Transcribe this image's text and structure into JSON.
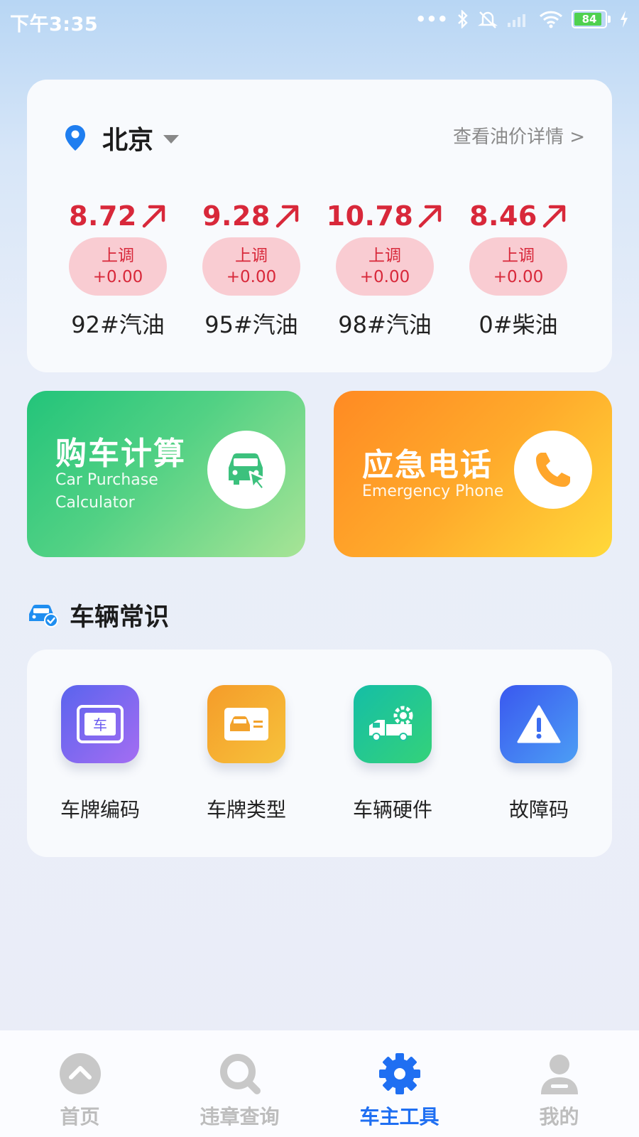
{
  "status_bar": {
    "time": "下午3:35",
    "battery": "84"
  },
  "header": {
    "city": "北京",
    "detail_link": "查看油价详情 >"
  },
  "fuel_prices": [
    {
      "price": "8.72",
      "trend": "上调",
      "change": "+0.00",
      "name": "92#汽油"
    },
    {
      "price": "9.28",
      "trend": "上调",
      "change": "+0.00",
      "name": "95#汽油"
    },
    {
      "price": "10.78",
      "trend": "上调",
      "change": "+0.00",
      "name": "98#汽油"
    },
    {
      "price": "8.46",
      "trend": "上调",
      "change": "+0.00",
      "name": "0#柴油"
    }
  ],
  "actions": {
    "purchase": {
      "title": "购车计算",
      "subtitle_line1": "Car Purchase",
      "subtitle_line2": "Calculator",
      "icon": "car-cursor-icon"
    },
    "emergency": {
      "title": "应急电话",
      "subtitle": "Emergency Phone",
      "icon": "phone-icon"
    }
  },
  "section": {
    "title": "车辆常识",
    "icon": "car-check-icon"
  },
  "tools": [
    {
      "label": "车牌编码",
      "icon": "plate-icon",
      "color": "#6b5cf0"
    },
    {
      "label": "车牌类型",
      "icon": "plate-card-icon",
      "color": "#f2a22c"
    },
    {
      "label": "车辆硬件",
      "icon": "truck-gear-icon",
      "color": "#22c4a0"
    },
    {
      "label": "故障码",
      "icon": "warning-icon",
      "color": "#3a6cf0"
    }
  ],
  "nav": [
    {
      "label": "首页",
      "icon": "home-icon",
      "active": false
    },
    {
      "label": "违章查询",
      "icon": "search-icon",
      "active": false
    },
    {
      "label": "车主工具",
      "icon": "gear-icon",
      "active": true
    },
    {
      "label": "我的",
      "icon": "user-icon",
      "active": false
    }
  ],
  "colors": {
    "accent": "#1f6ff2",
    "price_red": "#d8283a",
    "pill_bg": "#f9ccd2"
  }
}
